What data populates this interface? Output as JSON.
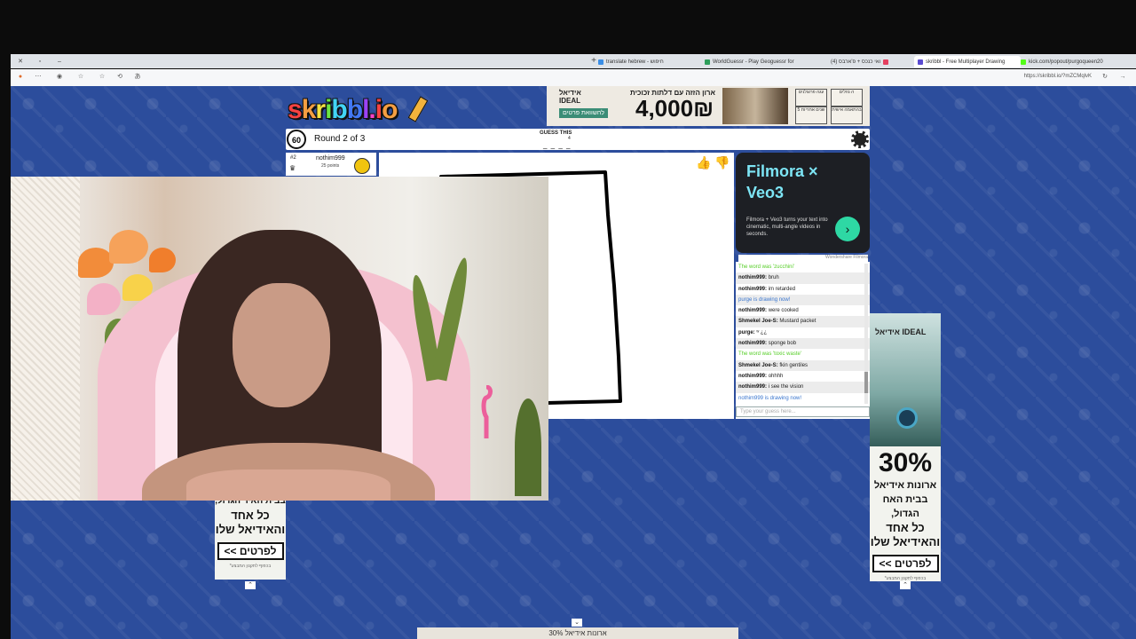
{
  "browser": {
    "tabs": [
      {
        "title": "translate hebrew - חיפוש",
        "favicon_color": "#3a8ee6"
      },
      {
        "title": "WorldGuessr - Play Geoguessr for",
        "favicon_color": "#2e9e5b"
      },
      {
        "title": "ואי כנכס + פ'ארבס (4)",
        "favicon_color": "#e4405f"
      },
      {
        "title": "skribbl - Free Multiplayer Drawing",
        "favicon_color": "#5a4bd1",
        "active": true
      },
      {
        "title": "kick.com/popout/purgoqueen20",
        "favicon_color": "#53fc18"
      }
    ],
    "url": "https://skribbl.io/?mZCMqlvK"
  },
  "game": {
    "logo": "skribbl.io",
    "logo_colors": [
      "#f54242",
      "#f59e42",
      "#f5e342",
      "#6be542",
      "#42d4f5",
      "#4279f5",
      "#9b42f5",
      "#f542c8",
      "#f54242",
      "#f59e42"
    ],
    "timer": "60",
    "round": "Round 2 of 3",
    "guess_label": "GUESS THIS",
    "guess_count": "4",
    "word_blanks": "_ _ _ _",
    "player": {
      "rank": "#2",
      "name": "nothim999",
      "points": "25 points"
    }
  },
  "top_ad": {
    "brand": "אידיאל",
    "brand_latin": "IDEAL",
    "button": "להשוואת פרטים",
    "headline": "ארון הזזה עם דלתות זכוכית",
    "price": "4,000₪",
    "badges": [
      "עגה פרוצלנים",
      "ה נוזלים",
      "5 שנים אחריות",
      "בהתאמה אישית"
    ]
  },
  "filmora_ad": {
    "title1": "Filmora ×",
    "title2": "Veo3",
    "description": "Filmora + Veo3 turns your text into cinematic, multi-angle videos in seconds.",
    "sponsor": "Wondershare Filmora"
  },
  "chat": {
    "messages": [
      {
        "type": "green",
        "text": "The word was 'zucchini'"
      },
      {
        "type": "msg",
        "user": "nothim999",
        "text": "bruh"
      },
      {
        "type": "msg",
        "user": "nothim999",
        "text": "im retarded"
      },
      {
        "type": "blue",
        "text": "purge is drawing now!"
      },
      {
        "type": "msg",
        "user": "nothim999",
        "text": "were cooked"
      },
      {
        "type": "msg",
        "user": "Shmekel Joe-S",
        "text": "Mustard packet"
      },
      {
        "type": "msg",
        "user": "purge",
        "text": "ʷ ¿¿"
      },
      {
        "type": "msg",
        "user": "nothim999",
        "text": "sponge bob"
      },
      {
        "type": "green",
        "text": "The word was 'toxic waste'"
      },
      {
        "type": "msg",
        "user": "Shmekel Joe-S",
        "text": "fkin gentiles"
      },
      {
        "type": "msg",
        "user": "nothim999",
        "text": "ohhhh"
      },
      {
        "type": "msg",
        "user": "nothim999",
        "text": "i see the vision"
      },
      {
        "type": "blue",
        "text": "nothim999 is drawing now!"
      }
    ],
    "input_placeholder": "Type your guess here..."
  },
  "left_ad": {
    "line1": "בבית האיר הגדול,",
    "line2": "כל אחד",
    "line3": "והאידיאל שלו",
    "button": "<< לפרטים",
    "small": "*בכפוף לתקנון המבצע"
  },
  "right_ad": {
    "brand": "אידיאל IDEAL",
    "percent": "30%",
    "line1": "ארונות אידיאל",
    "line2": "בבית האח הגדול,",
    "line3": "כל אחד",
    "line4": "והאידיאל שלו",
    "button": "<< לפרטים",
    "small": "*בכפוף לתקנון המבצע"
  },
  "bottom_ad": {
    "text": "ארונות אידיאל 30%"
  }
}
